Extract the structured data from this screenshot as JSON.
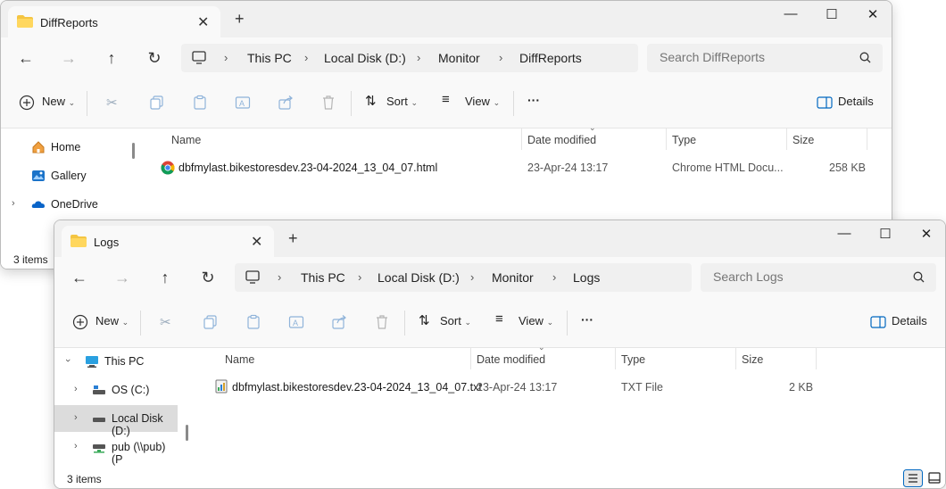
{
  "windows": [
    {
      "tab_title": "DiffReports",
      "breadcrumbs": [
        "This PC",
        "Local Disk (D:)",
        "Monitor",
        "DiffReports"
      ],
      "search_placeholder": "Search DiffReports",
      "toolbar": {
        "new": "New",
        "sort": "Sort",
        "view": "View",
        "more": "···",
        "details": "Details"
      },
      "sidebar": [
        {
          "label": "Home",
          "icon": "home-icon"
        },
        {
          "label": "Gallery",
          "icon": "gallery-icon"
        },
        {
          "label": "OneDrive",
          "icon": "onedrive-icon"
        }
      ],
      "columns": {
        "name": "Name",
        "date": "Date modified",
        "type": "Type",
        "size": "Size"
      },
      "files": [
        {
          "name": "dbfmylast.bikestoresdev.23-04-2024_13_04_07.html",
          "date": "23-Apr-24 13:17",
          "type": "Chrome HTML Docu...",
          "size": "258 KB",
          "icon": "chrome-icon"
        }
      ],
      "status": "3 items"
    },
    {
      "tab_title": "Logs",
      "breadcrumbs": [
        "This PC",
        "Local Disk (D:)",
        "Monitor",
        "Logs"
      ],
      "search_placeholder": "Search Logs",
      "toolbar": {
        "new": "New",
        "sort": "Sort",
        "view": "View",
        "more": "···",
        "details": "Details"
      },
      "sidebar": [
        {
          "label": "This PC",
          "icon": "pc-icon"
        },
        {
          "label": "OS (C:)",
          "icon": "drive-icon"
        },
        {
          "label": "Local Disk (D:)",
          "icon": "drive-icon"
        },
        {
          "label": "pub (\\\\pub) (P",
          "icon": "network-drive-icon"
        }
      ],
      "columns": {
        "name": "Name",
        "date": "Date modified",
        "type": "Type",
        "size": "Size"
      },
      "files": [
        {
          "name": "dbfmylast.bikestoresdev.23-04-2024_13_04_07.txt",
          "date": "23-Apr-24 13:17",
          "type": "TXT File",
          "size": "2 KB",
          "icon": "text-file-icon"
        }
      ],
      "status": "3 items"
    }
  ],
  "colors": {
    "folder": "#f4c542",
    "accent": "#0067c0",
    "selected": "#dcdcdc"
  }
}
